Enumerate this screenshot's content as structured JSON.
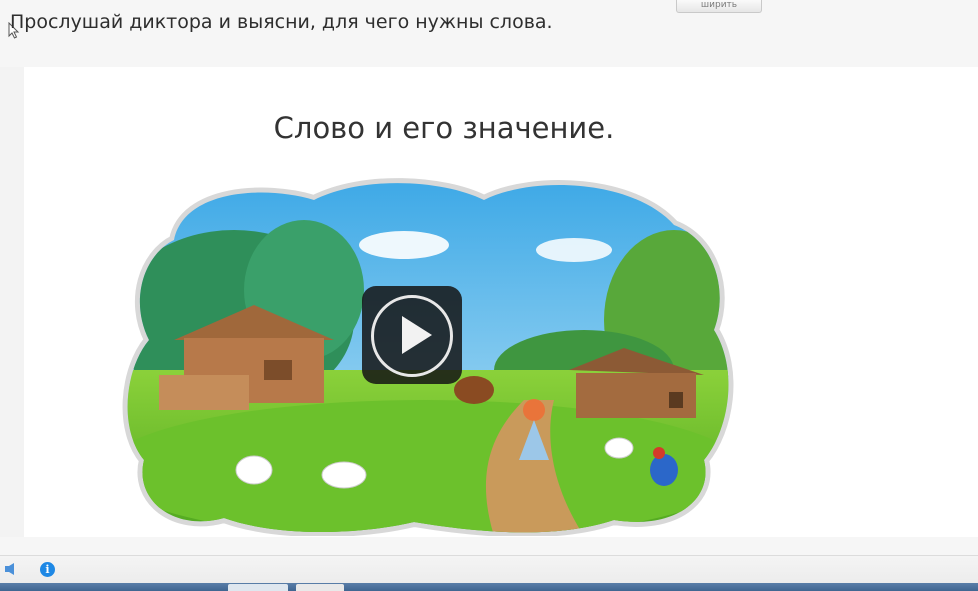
{
  "header": {
    "instruction": "Прослушай диктора и выясни, для чего нужны слова.",
    "top_button_label": "ширить"
  },
  "slide": {
    "title": "Слово и его значение."
  },
  "player": {
    "play_icon": "play-icon",
    "accent_color": "#1e88e5"
  },
  "status_bar": {
    "info_icon_glyph": "i"
  }
}
